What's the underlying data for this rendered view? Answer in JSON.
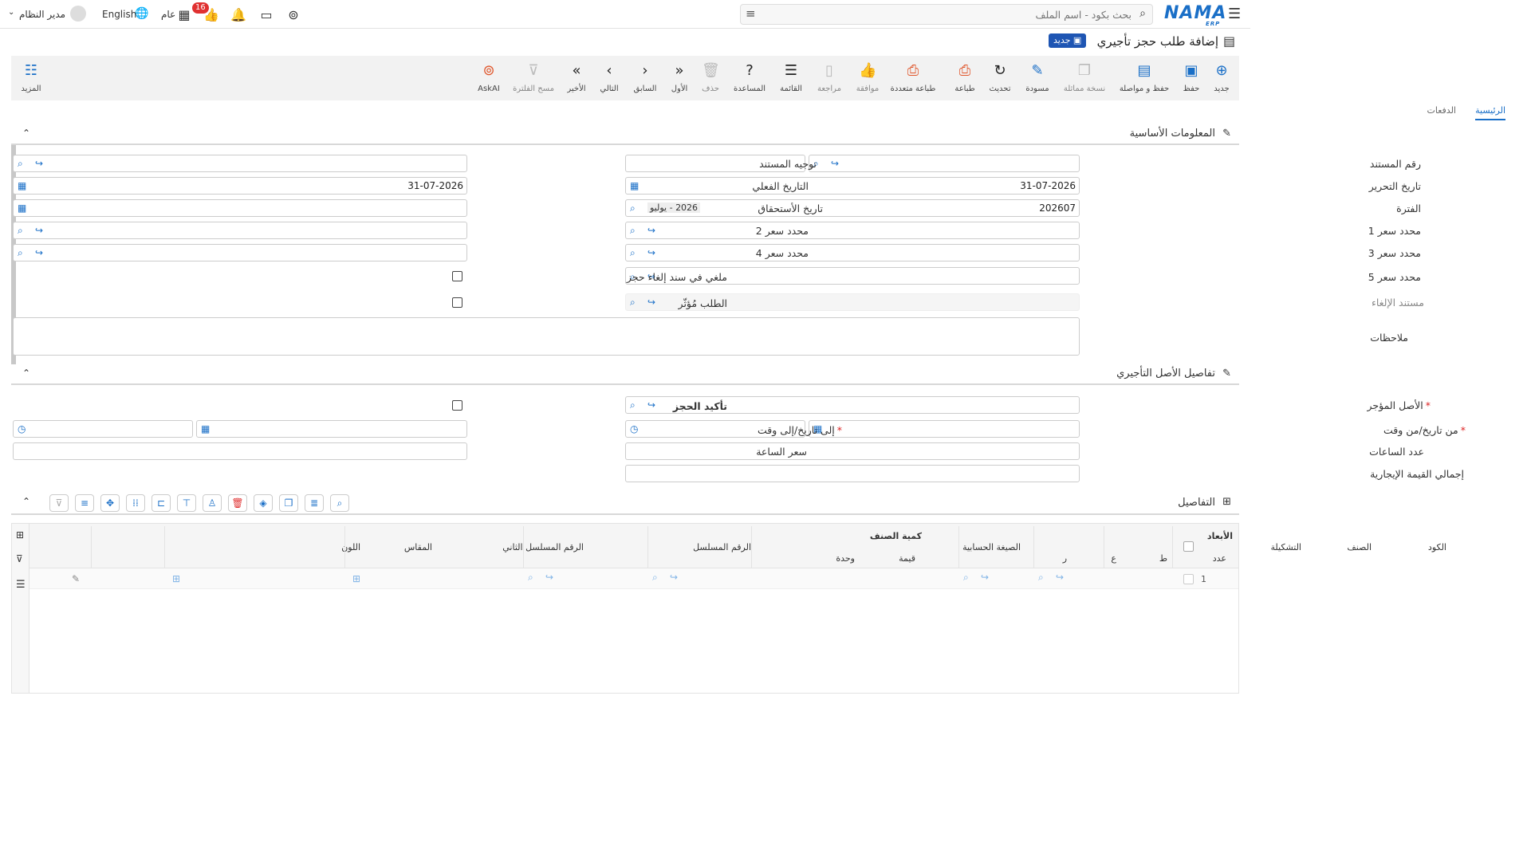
{
  "top": {
    "search_placeholder": "بحث بكود - اسم الملف",
    "user": "مدير النظام",
    "language": "English",
    "company": "عام",
    "badge": "16",
    "logo": "NAMA",
    "logo_sub": "ERP"
  },
  "title": {
    "text": "إضافة طلب حجز تأجيري",
    "state": "جديد"
  },
  "toolbar": {
    "items": [
      "جديد",
      "حفظ",
      "حفظ و مواصلة",
      "نسخة مماثلة",
      "مسودة",
      "تحديث",
      "طباعة",
      "طباعة متعددة",
      "موافقة",
      "مراجعة",
      "القائمة",
      "المساعدة",
      "حذف",
      "الأول",
      "السابق",
      "التالي",
      "الأخير",
      "مسح الفلترة",
      "AskAI"
    ],
    "more": "المزيد"
  },
  "tabs": [
    "الرئيسية",
    "الدفعات"
  ],
  "section1": {
    "title": "المعلومات الأساسية",
    "doc_no": "رقم المستند",
    "doc_direction": "توجيه المستند",
    "edit_date": "تاريخ التحرير",
    "edit_date_val": "31-07-2026",
    "actual_date": "التاريخ الفعلي",
    "actual_date_val": "31-07-2026",
    "period": "الفترة",
    "period_val": "202607",
    "period_name": "2026 - يوليو",
    "due_date": "تاريخ الأستحقاق",
    "price1": "محدد سعر 1",
    "price2": "محدد سعر 2",
    "price3": "محدد سعر 3",
    "price4": "محدد سعر 4",
    "price5": "محدد سعر 5",
    "cancelled": "ملغي في سند إلغاء حجز",
    "cancel_doc": "مستند الإلغاء",
    "affected": "الطلب مُؤثّر",
    "notes": "ملاحظات"
  },
  "section2": {
    "title": "تفاصيل الأصل التأجيري",
    "asset": "الأصل المؤجر",
    "confirm": "تأكيد الحجز",
    "from": "من تاريخ/من وقت",
    "to": "إلى تاريخ/إلى وقت",
    "hours": "عدد الساعات",
    "hour_price": "سعر الساعة",
    "total": "إجمالي القيمة الإيجارية"
  },
  "section3": {
    "title": "التفاصيل"
  },
  "grid": {
    "headers": {
      "code": "الكود",
      "item": "الصنف",
      "config": "التشكيلة",
      "dims": "الأبعاد",
      "count": "عدد",
      "l": "ط",
      "w": "ع",
      "r": "ر",
      "formula": "الصيغة الحسابية",
      "qty": "كمية الصنف",
      "value": "قيمة",
      "unit": "وحدة",
      "serial": "الرقم المسلسل",
      "serial2": "الرقم المسلسل الثاني",
      "size": "المقاس",
      "color": "اللون"
    },
    "row1": "1"
  }
}
